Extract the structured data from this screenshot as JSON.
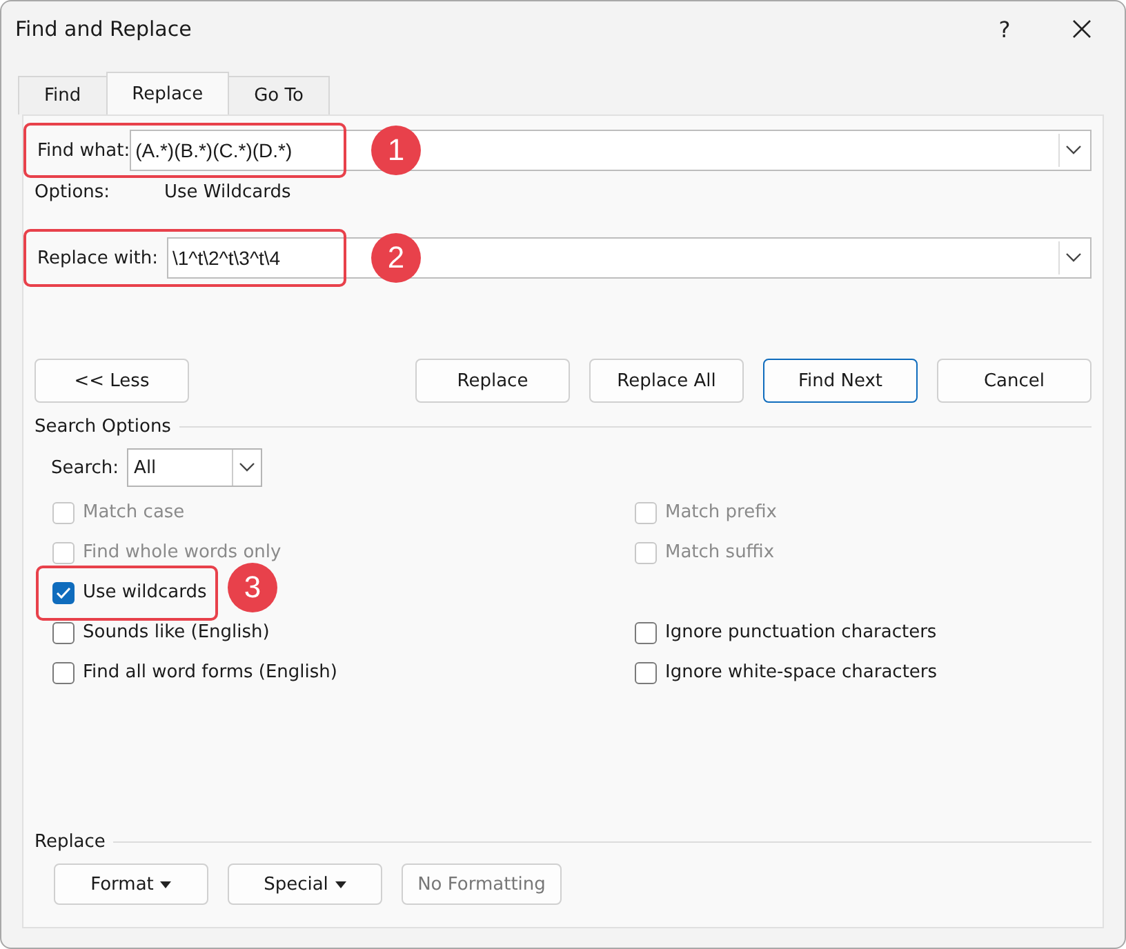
{
  "window": {
    "title": "Find and Replace",
    "help": "?"
  },
  "tabs": [
    {
      "label": "Find",
      "selected": false
    },
    {
      "label": "Replace",
      "selected": true
    },
    {
      "label": "Go To",
      "selected": false
    }
  ],
  "find": {
    "label": "Find what:",
    "value": "(A.*)(B.*)(C.*)(D.*)",
    "annotation": "1"
  },
  "options_info": {
    "label": "Options:",
    "value": "Use Wildcards"
  },
  "replace": {
    "label": "Replace with:",
    "value": "\\1^t\\2^t\\3^t\\4",
    "annotation": "2"
  },
  "buttons": [
    {
      "label": "<< Less",
      "default": false
    },
    {
      "label": "Replace",
      "default": false
    },
    {
      "label": "Replace All",
      "default": false
    },
    {
      "label": "Find Next",
      "default": true
    },
    {
      "label": "Cancel",
      "default": false
    }
  ],
  "search_options": {
    "title": "Search Options",
    "search_label": "Search:",
    "search_value": "All"
  },
  "option_rows": [
    [
      {
        "label": "Match case",
        "checked": false,
        "disabled": true
      },
      {
        "label": "Match prefix",
        "checked": false,
        "disabled": true
      }
    ],
    [
      {
        "label": "Find whole words only",
        "checked": false,
        "disabled": true
      },
      {
        "label": "Match suffix",
        "checked": false,
        "disabled": true
      }
    ],
    [
      {
        "label": "Use wildcards",
        "checked": true,
        "disabled": false,
        "annotation": "3"
      }
    ],
    [
      {
        "label": "Sounds like (English)",
        "checked": false,
        "disabled": false
      },
      {
        "label": "Ignore punctuation characters",
        "checked": false,
        "disabled": false
      }
    ],
    [
      {
        "label": "Find all word forms (English)",
        "checked": false,
        "disabled": false
      },
      {
        "label": "Ignore white-space characters",
        "checked": false,
        "disabled": false
      }
    ]
  ],
  "replace_section": {
    "title": "Replace",
    "buttons": [
      {
        "label": "Format",
        "dropdown": true,
        "disabled": false
      },
      {
        "label": "Special",
        "dropdown": true,
        "disabled": false
      },
      {
        "label": "No Formatting",
        "dropdown": false,
        "disabled": true
      }
    ]
  }
}
